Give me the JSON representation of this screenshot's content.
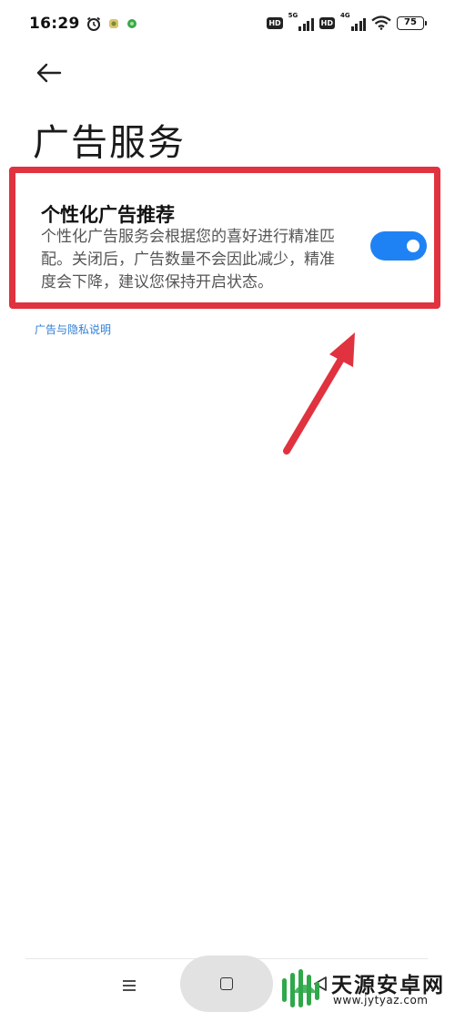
{
  "status_bar": {
    "time": "16:29",
    "battery": "75",
    "network_1": "5G",
    "network_2": "4G",
    "hd_1": "HD",
    "hd_2": "HD"
  },
  "header": {
    "title": "广告服务"
  },
  "setting": {
    "title": "个性化广告推荐",
    "description": "个性化广告服务会根据您的喜好进行精准匹配。关闭后，广告数量不会因此减少，精准度会下降，建议您保持开启状态。",
    "toggle_on": true
  },
  "privacy_link": "广告与隐私说明",
  "colors": {
    "accent": "#1f82f4",
    "annotation": "#e0323f",
    "link": "#2f7fd4"
  },
  "watermark": {
    "text": "天源安卓网",
    "url": "www.jytyaz.com"
  }
}
